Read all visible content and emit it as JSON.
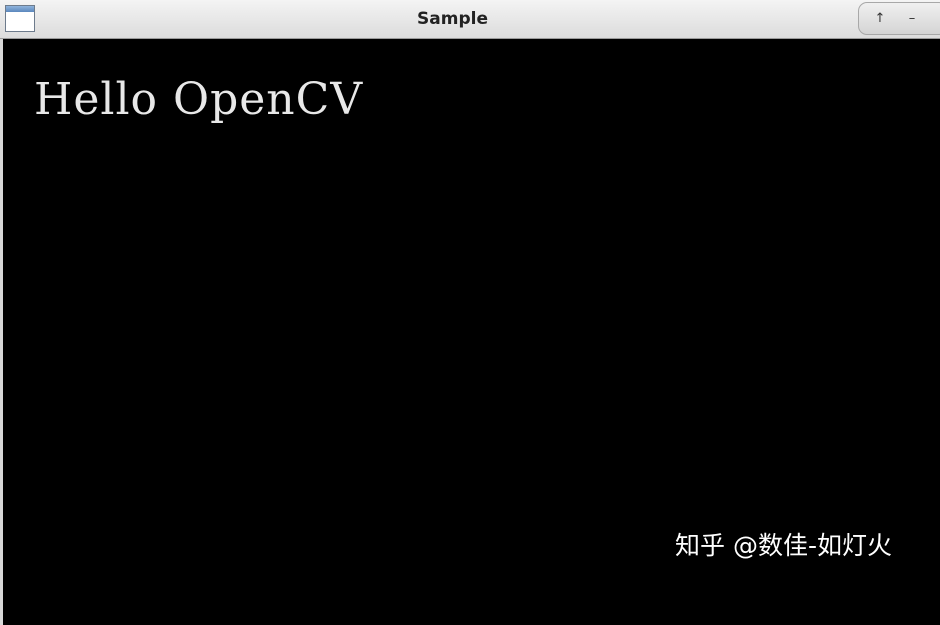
{
  "window": {
    "title": "Sample",
    "controls": {
      "maximize_glyph": "↑",
      "minimize_glyph": "–"
    }
  },
  "canvas": {
    "text": "Hello OpenCV",
    "background": "#000000",
    "text_color": "#e8e8e8"
  },
  "watermark": {
    "text": "知乎 @数佳-如灯火"
  },
  "icons": {
    "window_icon": "window-icon"
  }
}
